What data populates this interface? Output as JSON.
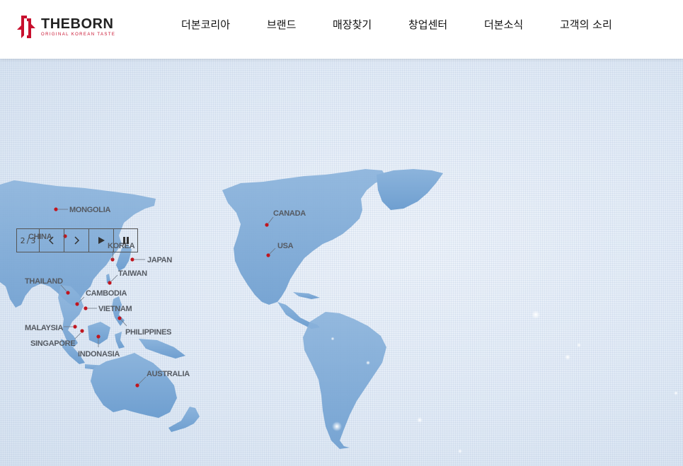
{
  "brand": {
    "name": "THEBORN",
    "tagline": "ORIGINAL KOREAN TASTE",
    "color": "#c8102e"
  },
  "nav": [
    {
      "label": "더본코리아"
    },
    {
      "label": "브랜드"
    },
    {
      "label": "매장찾기"
    },
    {
      "label": "창업센터"
    },
    {
      "label": "더본소식"
    },
    {
      "label": "고객의 소리"
    }
  ],
  "slider": {
    "current": "2",
    "separator": "/",
    "total": "3"
  },
  "map": {
    "countries": [
      "MONGOLIA",
      "CHINA",
      "KOREA",
      "JAPAN",
      "TAIWAN",
      "THAILAND",
      "CAMBODIA",
      "VIETNAM",
      "MALAYSIA",
      "SINGAPORE",
      "PHILIPPINES",
      "INDONASIA",
      "AUSTRALIA",
      "CANADA",
      "USA"
    ],
    "marker_color": "#c0161f",
    "land_color": "#7fa9d6"
  }
}
